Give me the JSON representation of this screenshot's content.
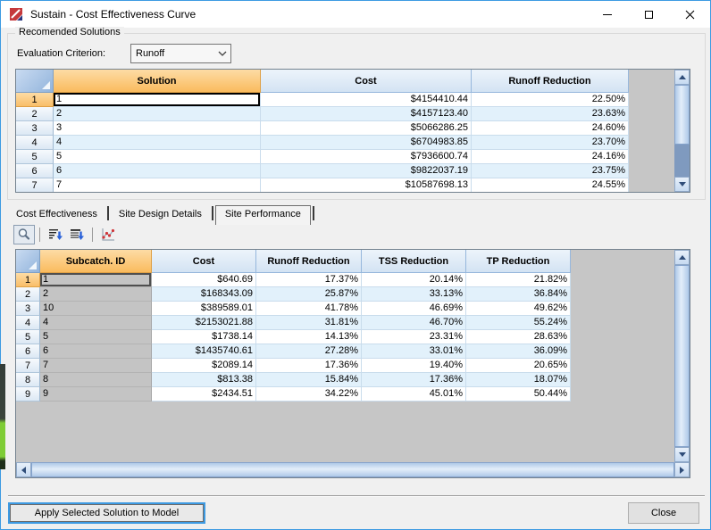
{
  "window": {
    "title": "Sustain - Cost Effectiveness Curve"
  },
  "recommended": {
    "group_title": "Recomended Solutions",
    "eval_label": "Evaluation Criterion:",
    "eval_value": "Runoff"
  },
  "grid1": {
    "columns": [
      "Solution",
      "Cost",
      "Runoff Reduction"
    ],
    "rows": [
      {
        "n": "1",
        "sol": "1",
        "cost": "$4154410.44",
        "ro": "22.50%"
      },
      {
        "n": "2",
        "sol": "2",
        "cost": "$4157123.40",
        "ro": "23.63%"
      },
      {
        "n": "3",
        "sol": "3",
        "cost": "$5066286.25",
        "ro": "24.60%"
      },
      {
        "n": "4",
        "sol": "4",
        "cost": "$6704983.85",
        "ro": "23.70%"
      },
      {
        "n": "5",
        "sol": "5",
        "cost": "$7936600.74",
        "ro": "24.16%"
      },
      {
        "n": "6",
        "sol": "6",
        "cost": "$9822037.19",
        "ro": "23.75%"
      },
      {
        "n": "7",
        "sol": "7",
        "cost": "$10587698.13",
        "ro": "24.55%"
      }
    ]
  },
  "tabs": [
    {
      "label": "Cost Effectiveness",
      "active": false
    },
    {
      "label": "Site Design Details",
      "active": false
    },
    {
      "label": "Site Performance",
      "active": true
    }
  ],
  "grid2": {
    "columns": [
      "Subcatch. ID",
      "Cost",
      "Runoff Reduction",
      "TSS Reduction",
      "TP Reduction"
    ],
    "rows": [
      {
        "n": "1",
        "id": "1",
        "cost": "$640.69",
        "ro": "17.37%",
        "tss": "20.14%",
        "tp": "21.82%"
      },
      {
        "n": "2",
        "id": "2",
        "cost": "$168343.09",
        "ro": "25.87%",
        "tss": "33.13%",
        "tp": "36.84%"
      },
      {
        "n": "3",
        "id": "10",
        "cost": "$389589.01",
        "ro": "41.78%",
        "tss": "46.69%",
        "tp": "49.62%"
      },
      {
        "n": "4",
        "id": "4",
        "cost": "$2153021.88",
        "ro": "31.81%",
        "tss": "46.70%",
        "tp": "55.24%"
      },
      {
        "n": "5",
        "id": "5",
        "cost": "$1738.14",
        "ro": "14.13%",
        "tss": "23.31%",
        "tp": "28.63%"
      },
      {
        "n": "6",
        "id": "6",
        "cost": "$1435740.61",
        "ro": "27.28%",
        "tss": "33.01%",
        "tp": "36.09%"
      },
      {
        "n": "7",
        "id": "7",
        "cost": "$2089.14",
        "ro": "17.36%",
        "tss": "19.40%",
        "tp": "20.65%"
      },
      {
        "n": "8",
        "id": "8",
        "cost": "$813.38",
        "ro": "15.84%",
        "tss": "17.36%",
        "tp": "18.07%"
      },
      {
        "n": "9",
        "id": "9",
        "cost": "$2434.51",
        "ro": "34.22%",
        "tss": "45.01%",
        "tp": "50.44%"
      }
    ]
  },
  "footer": {
    "apply_label": "Apply Selected Solution to Model",
    "close_label": "Close"
  },
  "icons": {
    "title": "sustain-logo",
    "window_controls": [
      "minimize",
      "maximize",
      "close"
    ],
    "toolbar": [
      "magnifier",
      "import-lines-arrow",
      "export-lines-arrow",
      "scatter-chart"
    ]
  },
  "colors": {
    "window_border": "#3D9BE2",
    "header_blue": "#D3E3F3",
    "header_orange": "#FABB5E",
    "row_alt": "#E2F1FB",
    "readonly_gray": "#C4C4C4",
    "scrollbar_thumb": "#C9DCF3",
    "scrollbar_track": "#7F9ABF"
  }
}
